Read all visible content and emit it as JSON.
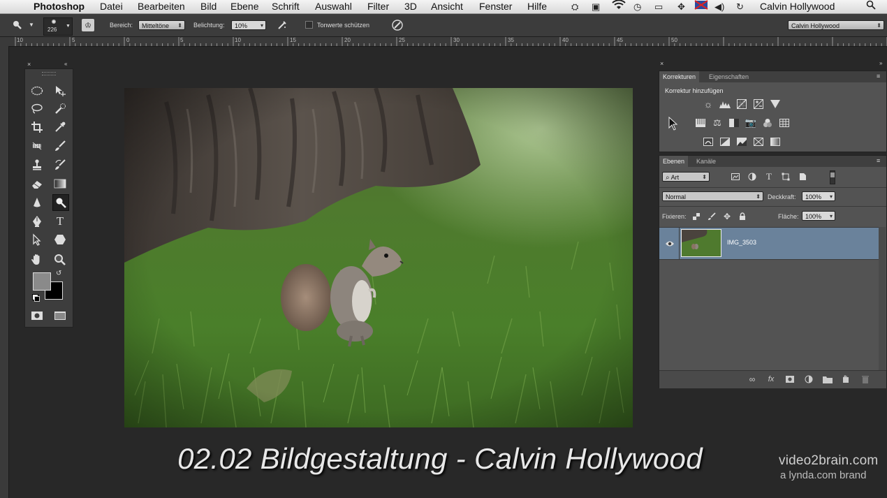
{
  "menubar": {
    "app": "Photoshop",
    "items": [
      "Datei",
      "Bearbeiten",
      "Bild",
      "Ebene",
      "Schrift",
      "Auswahl",
      "Filter",
      "3D",
      "Ansicht",
      "Fenster",
      "Hilfe"
    ],
    "user": "Calvin  Hollywood"
  },
  "options": {
    "brush_size": "226",
    "bereich_label": "Bereich:",
    "bereich_value": "Mitteltöne",
    "belichtung_label": "Belichtung:",
    "belichtung_value": "10%",
    "tonwerte_label": "Tonwerte schützen",
    "workspace": "Calvin Hollywood"
  },
  "ruler": {
    "labels": [
      "10",
      "5",
      "0",
      "5",
      "10",
      "15",
      "20",
      "25",
      "30",
      "35",
      "40",
      "45",
      "50"
    ]
  },
  "adjustments": {
    "tab_active": "Korrekturen",
    "tab_other": "Eigenschaften",
    "heading": "Korrektur hinzufügen"
  },
  "layers": {
    "tab_active": "Ebenen",
    "tab_other": "Kanäle",
    "filter_value": "Art",
    "blend_mode": "Normal",
    "opacity_label": "Deckkraft:",
    "opacity_value": "100%",
    "lock_label": "Fixieren:",
    "fill_label": "Fläche:",
    "fill_value": "100%",
    "layer_name": "IMG_3503"
  },
  "footer": {
    "title": "02.02 Bildgestaltung - Calvin Hollywood",
    "brand_main": "video2brain.com",
    "brand_sub": "a lynda.com brand"
  },
  "colors": {
    "panel_bg": "#535353",
    "selected_layer": "#6a829b",
    "canvas_bg": "#282828"
  }
}
